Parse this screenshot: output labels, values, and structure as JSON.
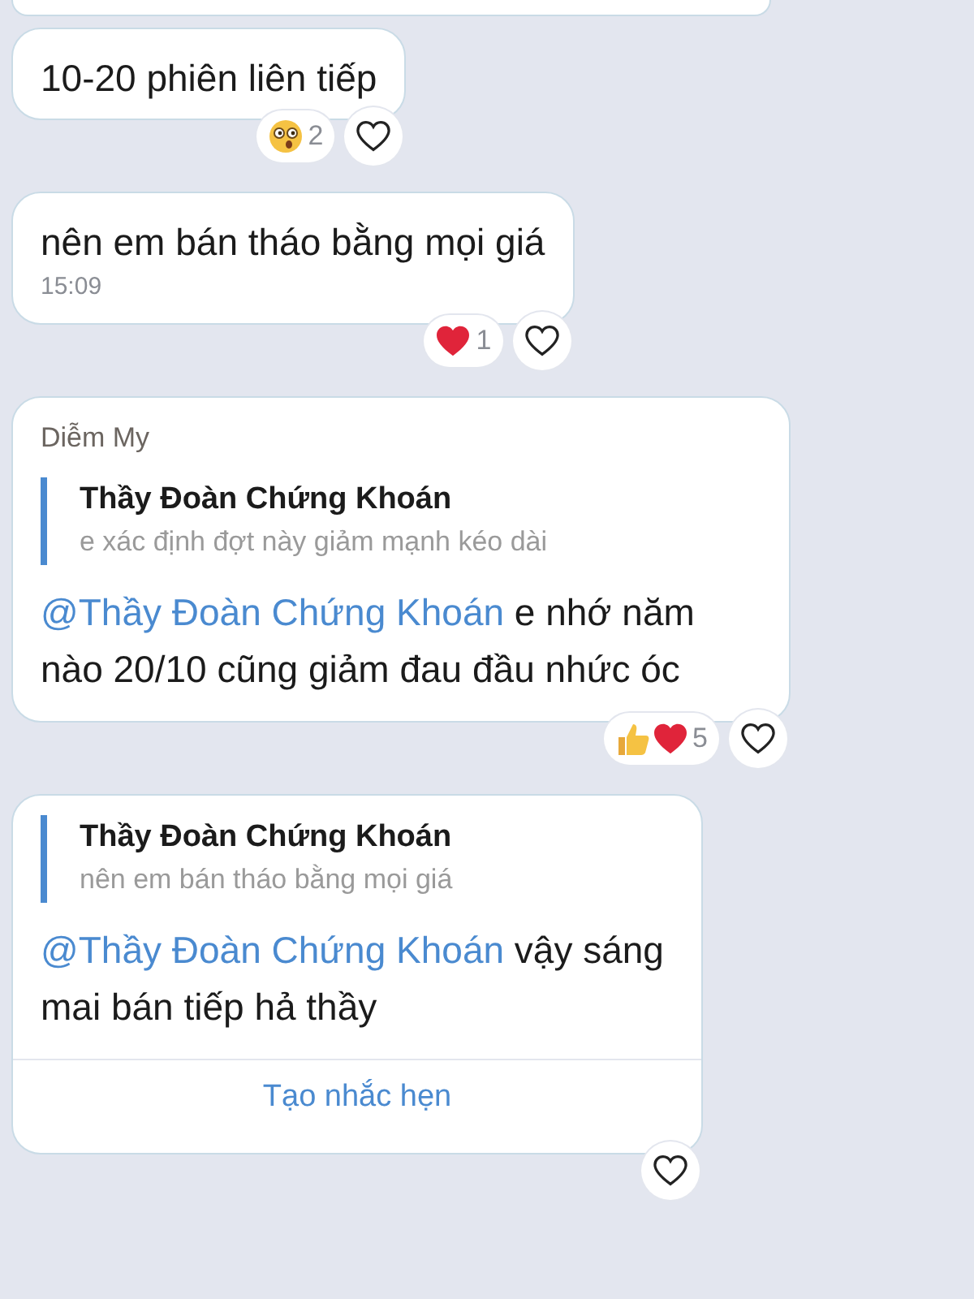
{
  "messages": [
    {
      "kind": "text",
      "text": "10-20 phiên liên tiếp",
      "reactions": {
        "emojis": [
          {
            "kind": "wow"
          }
        ],
        "count": "2"
      }
    },
    {
      "kind": "text",
      "text": "nên em bán tháo bằng mọi giá",
      "time": "15:09",
      "reactions": {
        "emojis": [
          {
            "kind": "heart"
          }
        ],
        "count": "1"
      }
    },
    {
      "kind": "reply",
      "sender": "Diễm My",
      "quote": {
        "author": "Thầy Đoàn Chứng Khoán",
        "text": "e xác định đợt này giảm mạnh kéo dài"
      },
      "mention": "@Thầy Đoàn Chứng Khoán",
      "text": "e nhớ năm nào 20/10 cũng giảm đau đầu nhức óc",
      "reactions": {
        "emojis": [
          {
            "kind": "like"
          },
          {
            "kind": "heart"
          }
        ],
        "count": "5"
      }
    },
    {
      "kind": "reply",
      "quote": {
        "author": "Thầy Đoàn Chứng Khoán",
        "text": "nên em bán tháo bằng mọi giá"
      },
      "mention": "@Thầy Đoàn Chứng Khoán",
      "text": "vậy sáng mai bán tiếp hả thầy",
      "action": "Tạo nhắc hẹn"
    }
  ]
}
